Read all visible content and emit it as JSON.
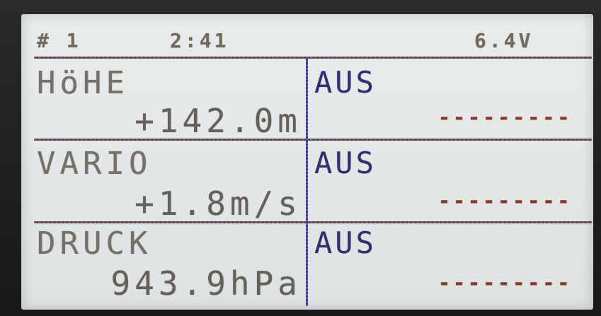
{
  "status_bar": {
    "model": "# 1",
    "timer": "2:41",
    "voltage": "6.4V"
  },
  "rows": [
    {
      "label": "HöHE",
      "value": "+142.0m",
      "right_label": "AUS",
      "right_value": "---------"
    },
    {
      "label": "VARIO",
      "value": "+1.8m/s",
      "right_label": "AUS",
      "right_value": "---------"
    },
    {
      "label": "DRUCK",
      "value": "943.9hPa",
      "right_label": "AUS",
      "right_value": "---------"
    }
  ]
}
